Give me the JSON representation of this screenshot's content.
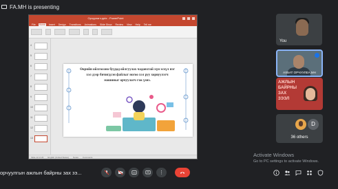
{
  "presenter": {
    "label": "FA.MH is presenting"
  },
  "powerpoint": {
    "window_title": "Орчуулагч.pptx - PowerPoint",
    "tabs": [
      "File",
      "Home",
      "Insert",
      "Design",
      "Transitions",
      "Animations",
      "Slide Show",
      "Review",
      "View",
      "Help",
      "Tell me"
    ],
    "slide_numbers": [
      "4",
      "5",
      "6",
      "7",
      "8",
      "9",
      "10",
      "11",
      "12",
      "13"
    ],
    "status": [
      "Slide 12 of 20",
      "English (United States)",
      "Notes",
      "Comments"
    ],
    "slide_text": "Өөрийн өйлгосоно буудад өйлгуулах чадавхтай хүн эсхүл нэг хэл дээр бичигдсэн файлыг ногоо хэл руу хорвуулэгч машиныг орчуулагч гэж үзнэ."
  },
  "participants": {
    "you": {
      "name": "You"
    },
    "speaker": {
      "name": "АХБАТ ОРЧУУЛЕА.МН"
    },
    "red_tile": {
      "lines": [
        "АЖЛЫН",
        "БАЙРНЫ",
        "ЗАХ",
        "ЗЭЭЛ"
      ]
    },
    "others": {
      "avatar_letter": "D",
      "count": "36 others"
    }
  },
  "watermark": {
    "title": "Activate Windows",
    "subtitle": "Go to PC settings to activate Windows."
  },
  "bottom": {
    "meeting_name": "орчуулгын ажлын байрны зах зэ..."
  },
  "colors": {
    "end_call": "#ea4335",
    "accent": "#8ab4f8",
    "ppt_red": "#c4472f"
  }
}
